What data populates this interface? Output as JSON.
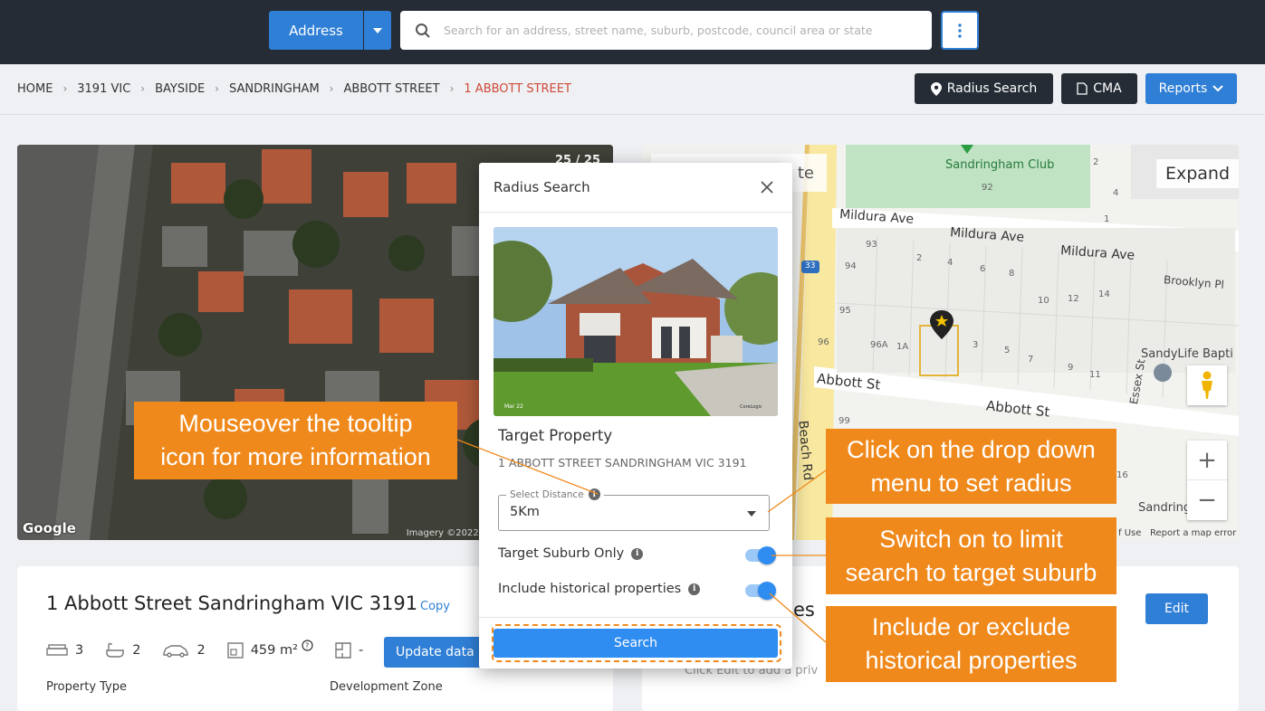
{
  "topbar": {
    "address_label": "Address",
    "search_placeholder": "Search for an address, street name, suburb, postcode, council area or state"
  },
  "breadcrumb": [
    "HOME",
    "3191 VIC",
    "BAYSIDE",
    "SANDRINGHAM",
    "ABBOTT STREET",
    "1 ABBOTT STREET"
  ],
  "header_buttons": {
    "radius": "Radius Search",
    "cma": "CMA",
    "reports": "Reports"
  },
  "aerial": {
    "counter": "25 / 25",
    "google": "Google",
    "imagery": "Imagery ©2022 CNES"
  },
  "map": {
    "expand": "Expand",
    "satellite": "te",
    "labels": {
      "club": "Sandringham Club",
      "mildura1": "Mildura Ave",
      "mildura2": "Mildura Ave",
      "mildura3": "Mildura Ave",
      "brooklyn": "Brooklyn Pl",
      "abbott1": "Abbott St",
      "abbott2": "Abbott St",
      "essex": "Essex St",
      "beach": "Beach Rd",
      "church": "SandyLife Bapti",
      "sandringham": "Sandringha",
      "route": "33"
    },
    "footer_terms": "f Use",
    "footer_report": "Report a map error",
    "numbers": [
      "2",
      "4",
      "92",
      "1",
      "93",
      "2",
      "4",
      "6",
      "8",
      "94",
      "95",
      "96",
      "96A",
      "1A",
      "3",
      "5",
      "7",
      "9",
      "10",
      "12",
      "14",
      "11",
      "16",
      "99"
    ]
  },
  "property": {
    "title": "1 Abbott Street Sandringham VIC 3191",
    "copy": "Copy",
    "beds": "3",
    "baths": "2",
    "cars": "2",
    "land": "459 m²",
    "floor": "-",
    "update_btn": "Update data",
    "property_type_label": "Property Type",
    "dev_zone_label": "Development Zone"
  },
  "notes": {
    "title": "es",
    "edit": "Edit",
    "hint": "Click Edit to add a priv"
  },
  "modal": {
    "title": "Radius Search",
    "photo_stamp": "Mar 22",
    "photo_brand": "CoreLogic",
    "target_label": "Target Property",
    "target_address": "1 ABBOTT STREET SANDRINGHAM VIC 3191",
    "distance_legend": "Select Distance",
    "distance_value": "5Km",
    "suburb_only_label": "Target Suburb Only",
    "suburb_only_on": true,
    "historical_label": "Include historical properties",
    "historical_on": true,
    "search_btn": "Search"
  },
  "callouts": {
    "tooltip": [
      "Mouseover the tooltip",
      "icon for more information"
    ],
    "dropdown": [
      "Click on the drop down",
      "menu to set radius"
    ],
    "switch": [
      "Switch on to limit",
      "search to target suburb"
    ],
    "historical": [
      "Include or exclude",
      "historical properties"
    ]
  },
  "colors": {
    "topbar": "#252c35",
    "primary": "#2f7fd6",
    "callout": "#f0891c",
    "breadcrumb_active": "#d04a3a"
  }
}
